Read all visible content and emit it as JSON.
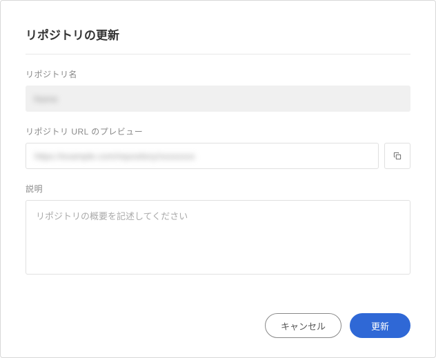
{
  "dialog": {
    "title": "リポジトリの更新"
  },
  "fields": {
    "name": {
      "label": "リポジトリ名",
      "value_masked": "Name"
    },
    "url": {
      "label": "リポジトリ URL のプレビュー",
      "value_masked": "https://example.com/repository/xxxxxxxx"
    },
    "description": {
      "label": "説明",
      "placeholder": "リポジトリの概要を記述してください",
      "value": ""
    }
  },
  "buttons": {
    "cancel": "キャンセル",
    "submit": "更新"
  }
}
